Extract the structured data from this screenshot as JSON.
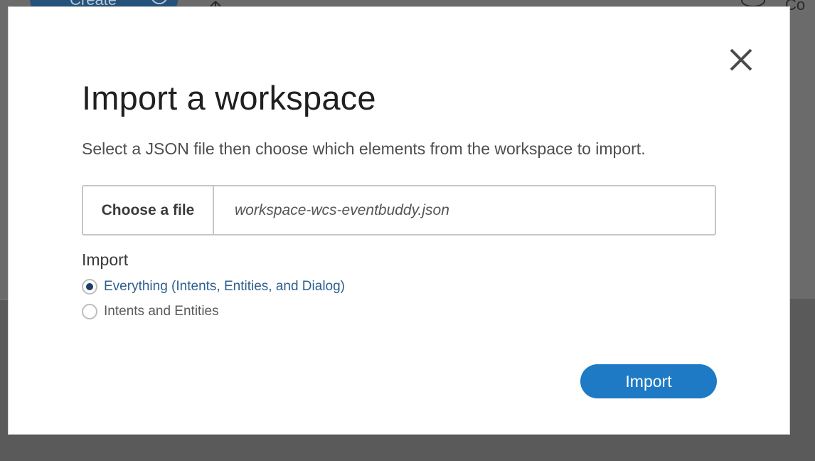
{
  "background": {
    "create_label": "Create",
    "partial_label": "Co"
  },
  "modal": {
    "title": "Import a workspace",
    "subtitle": "Select a JSON file then choose which elements from the workspace to import.",
    "file_picker": {
      "button_label": "Choose a file",
      "file_name": "workspace-wcs-eventbuddy.json"
    },
    "import_section": {
      "label": "Import",
      "options": [
        {
          "label": "Everything (Intents, Entities, and Dialog)",
          "selected": true
        },
        {
          "label": "Intents and Entities",
          "selected": false
        }
      ]
    },
    "import_button_label": "Import",
    "close_icon": "close-icon"
  },
  "colors": {
    "primary": "#1e7ac4",
    "selected_text": "#2c5f8f",
    "overlay": "#5a5a5a"
  }
}
